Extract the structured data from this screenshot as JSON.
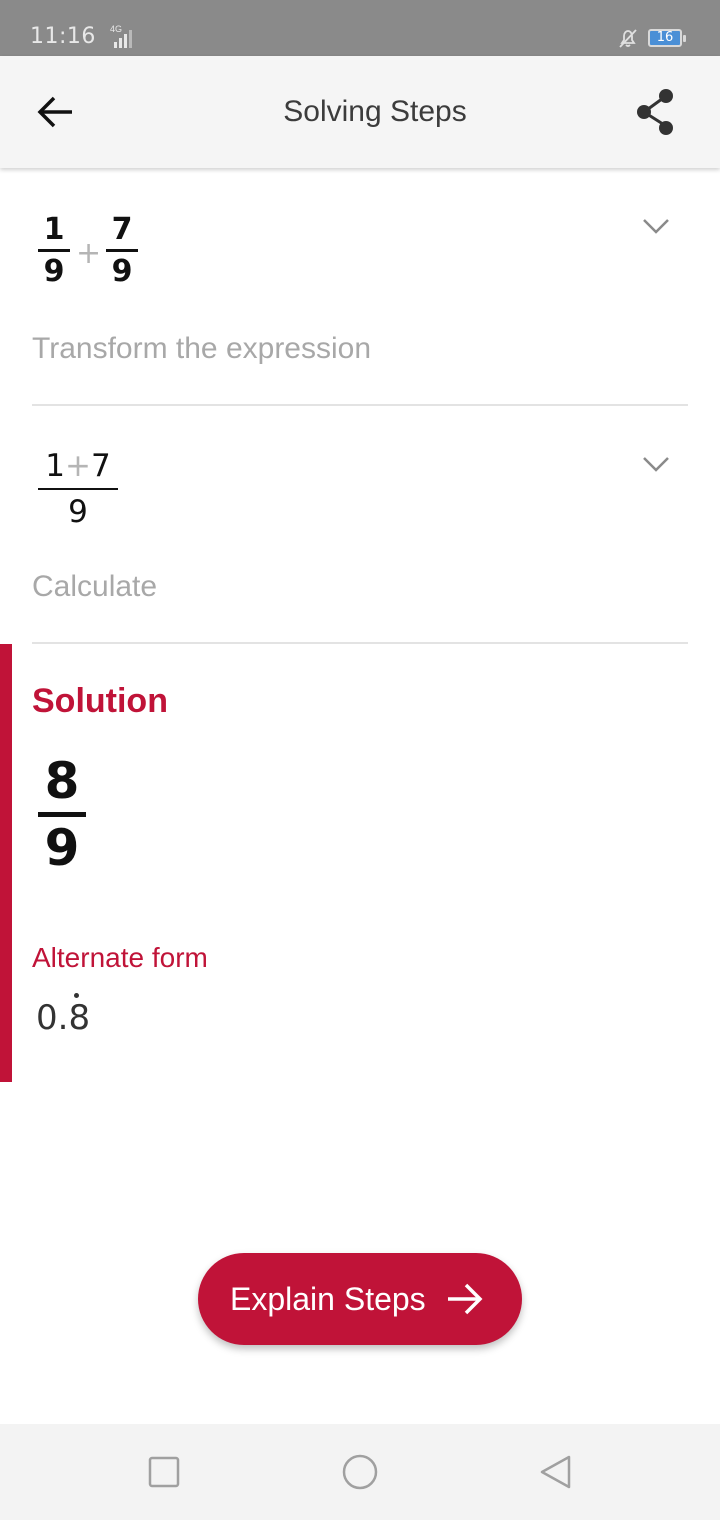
{
  "status_bar": {
    "time": "11:16",
    "network": "4G",
    "battery": "16"
  },
  "app_bar": {
    "title": "Solving Steps",
    "back_icon": "arrow-left-icon",
    "share_icon": "share-icon"
  },
  "steps": [
    {
      "expression": {
        "left": {
          "num": "1",
          "den": "9"
        },
        "operator": "+",
        "right": {
          "num": "7",
          "den": "9"
        }
      },
      "label": "Transform the expression"
    },
    {
      "expression": {
        "num_left": "1",
        "operator": "+",
        "num_right": "7",
        "den": "9"
      },
      "label": "Calculate"
    }
  ],
  "solution": {
    "title": "Solution",
    "num": "8",
    "den": "9",
    "alternate_title": "Alternate form",
    "alternate_value": "0.8",
    "alternate_note": "repeating decimal (dot over 8)"
  },
  "explain_button": {
    "label": "Explain Steps",
    "icon": "arrow-right-icon"
  },
  "nav_bar": {
    "recent_icon": "square-icon",
    "home_icon": "circle-icon",
    "back_icon": "triangle-back-icon"
  },
  "colors": {
    "accent": "#c01338",
    "status_bar": "#8a8a8a",
    "app_bar": "#f5f5f5",
    "muted_text": "#a8a8a8"
  }
}
